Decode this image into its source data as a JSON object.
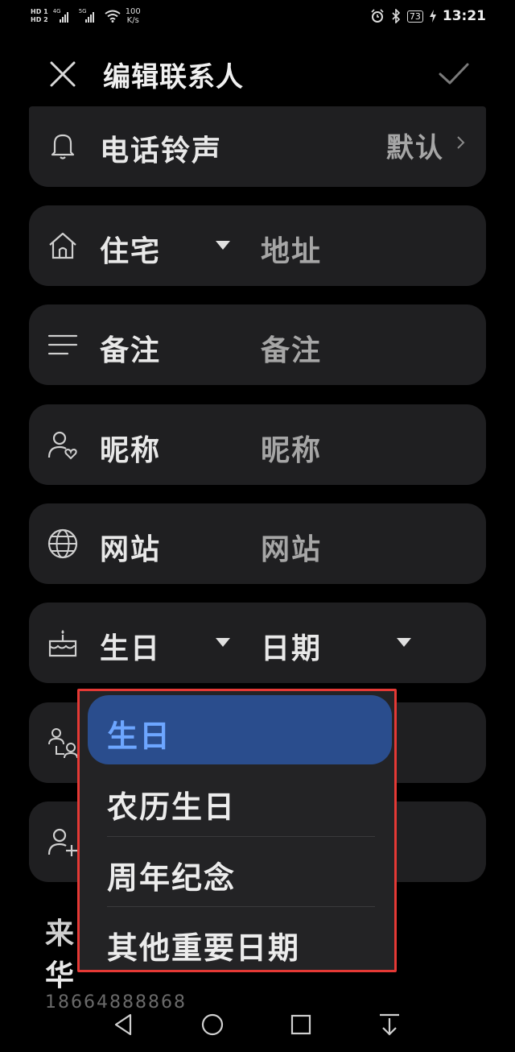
{
  "status_bar": {
    "sim1": "HD 1",
    "sim2": "HD 2",
    "sig1_label": "4G",
    "sig2_label": "5G",
    "net_speed_value": "100",
    "net_speed_unit": "K/s",
    "battery": "73",
    "time": "13:21"
  },
  "header": {
    "title": "编辑联系人"
  },
  "rows": {
    "ringtone": {
      "label": "电话铃声",
      "value": "默认"
    },
    "address": {
      "label": "住宅",
      "value": "地址"
    },
    "note": {
      "label": "备注",
      "value": "备注"
    },
    "nickname": {
      "label": "昵称",
      "value": "昵称"
    },
    "website": {
      "label": "网站",
      "value": "网站"
    },
    "birthday": {
      "label": "生日",
      "value": "日期"
    }
  },
  "background_text": {
    "line1": "来",
    "line2": "华",
    "line3": "18664888868"
  },
  "dropdown": {
    "options": [
      "生日",
      "农历生日",
      "周年纪念",
      "其他重要日期"
    ],
    "selected_index": 0
  },
  "colors": {
    "background": "#000000",
    "card": "#1f1f21",
    "selected_bg": "#2a4d8d",
    "selected_text": "#6da6ff",
    "highlight_border": "#e53935"
  },
  "icons": [
    "bell-icon",
    "home-icon",
    "notes-icon",
    "person-heart-icon",
    "globe-icon",
    "cake-icon",
    "relation-icon",
    "person-add-icon",
    "close-icon",
    "check-icon"
  ]
}
